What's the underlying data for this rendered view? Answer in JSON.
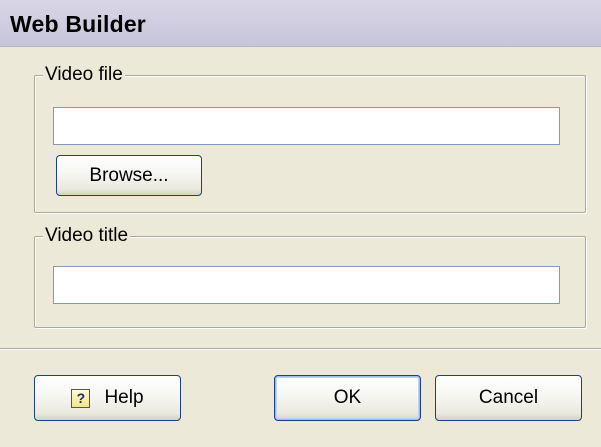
{
  "window": {
    "title": "Web Builder"
  },
  "video_file": {
    "group_label": "Video file",
    "value": "",
    "placeholder": "",
    "browse_label": "Browse..."
  },
  "video_title": {
    "group_label": "Video title",
    "value": "",
    "placeholder": ""
  },
  "footer": {
    "help_label": "Help",
    "help_icon_glyph": "?",
    "ok_label": "OK",
    "cancel_label": "Cancel"
  },
  "icons": {
    "help": "help-icon"
  },
  "colors": {
    "dialog_background": "#ece9d8",
    "title_bar": "#cfcde0",
    "button_border": "#1c3f8a",
    "input_border": "#7f9db9"
  }
}
